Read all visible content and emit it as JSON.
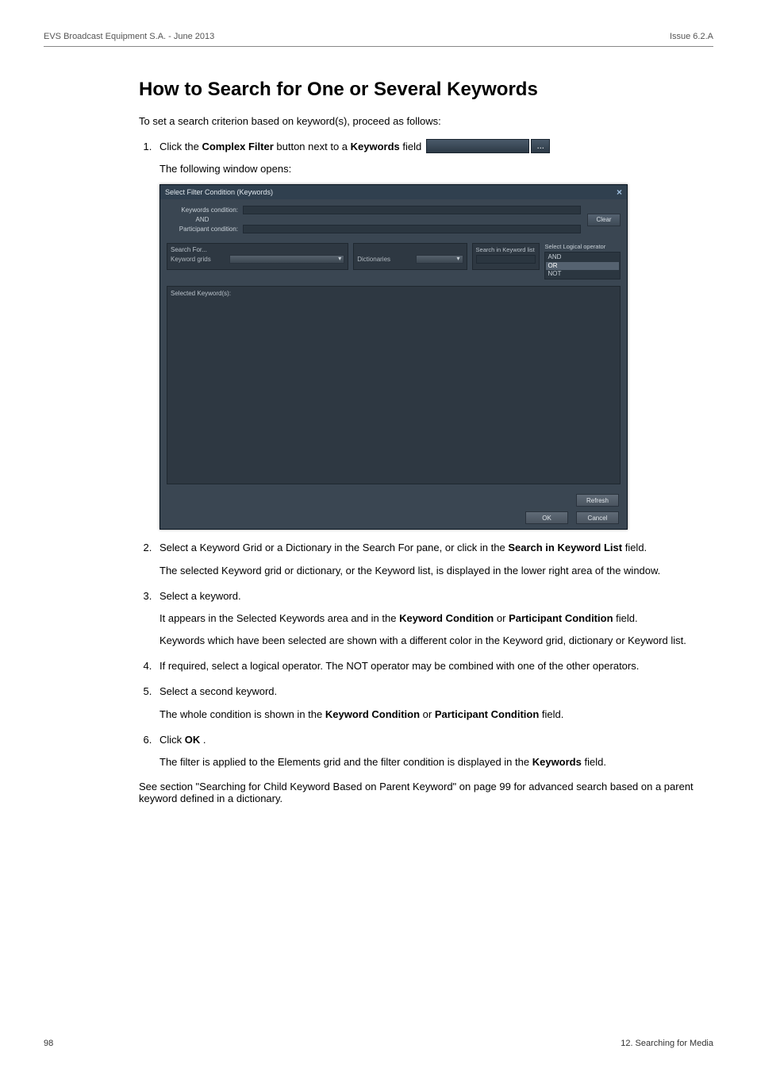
{
  "header": {
    "left": "EVS Broadcast Equipment S.A. - June 2013",
    "right": "Issue 6.2.A"
  },
  "title": "How to Search for One or Several Keywords",
  "intro": "To set a search criterion based on keyword(s), proceed as follows:",
  "step1": {
    "pre": "Click the ",
    "b1": "Complex Filter",
    "mid1": " button next to a ",
    "b2": "Keywords",
    "post": " field ",
    "ellipsis": "...",
    "line2": "The following window opens:"
  },
  "dialog": {
    "title": "Select Filter Condition (Keywords)",
    "keywords_condition_lbl": "Keywords condition:",
    "participant_condition_lbl": "Participant condition:",
    "and": "AND",
    "clear": "Clear",
    "search_for": "Search For...",
    "keyword_grids": "Keyword grids",
    "dictionaries": "Dictionaries",
    "search_in_keyword_list": "Search in Keyword list",
    "select_logical_operator": "Select Logical operator",
    "logops": [
      "AND",
      "OR",
      "NOT"
    ],
    "selected_keywords": "Selected Keyword(s):",
    "refresh": "Refresh",
    "ok": "OK",
    "cancel": "Cancel"
  },
  "step2": {
    "p1_a": "Select a Keyword Grid or a Dictionary in the Search For pane, or click in the ",
    "p1_b": "Search in Keyword List",
    "p1_c": " field.",
    "p2": "The selected Keyword grid or dictionary, or the Keyword list, is displayed in the lower right area of the window."
  },
  "step3": {
    "p1": "Select a keyword.",
    "p2_a": "It appears in the Selected Keywords area and in the ",
    "p2_b": "Keyword Condition",
    "p2_c": " or ",
    "p2_d": "Participant Condition",
    "p2_e": " field.",
    "p3": "Keywords which have been selected are shown with a different color in the Keyword grid, dictionary or Keyword list."
  },
  "step4": "If required, select a logical operator. The NOT operator may be combined with one of the other operators.",
  "step5": {
    "p1": "Select a second keyword.",
    "p2_a": "The whole condition is shown in the ",
    "p2_b": "Keyword Condition",
    "p2_c": " or ",
    "p2_d": "Participant Condition",
    "p2_e": " field."
  },
  "step6": {
    "p1_a": "Click ",
    "p1_b": "OK",
    "p1_c": ".",
    "p2_a": "The filter is applied to the Elements grid and the filter condition is displayed in the ",
    "p2_b": "Keywords",
    "p2_c": " field."
  },
  "outro": "See section \"Searching for Child Keyword Based on Parent Keyword\" on page 99 for advanced search based on a parent keyword defined in a dictionary.",
  "footer": {
    "left": "98",
    "right": "12. Searching for Media"
  }
}
